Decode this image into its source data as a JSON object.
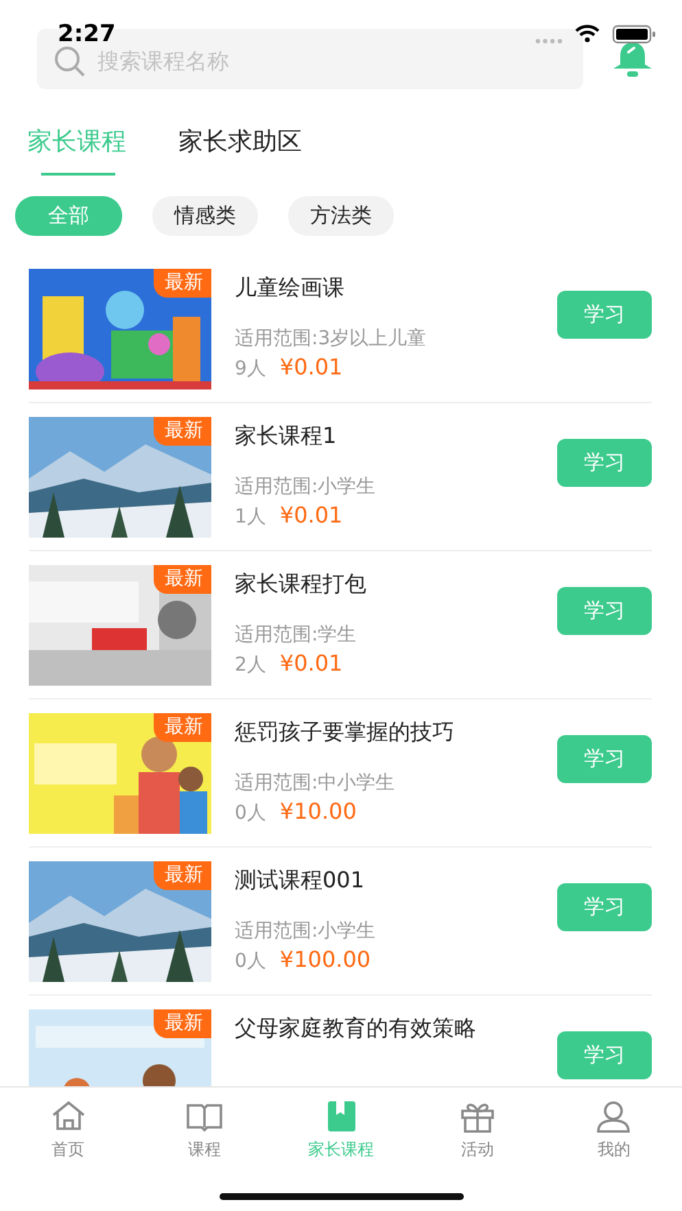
{
  "status_bar": {
    "time": "2:27"
  },
  "search": {
    "placeholder": "搜索课程名称"
  },
  "tabs": [
    {
      "label": "家长课程",
      "selected": true
    },
    {
      "label": "家长求助区",
      "selected": false
    }
  ],
  "filters": [
    {
      "label": "全部",
      "selected": true
    },
    {
      "label": "情感类",
      "selected": false
    },
    {
      "label": "方法类",
      "selected": false
    }
  ],
  "courses": [
    {
      "title": "儿童绘画课",
      "badge": "最新",
      "scope": "适用范围:3岁以上儿童",
      "count": "9人",
      "price": "¥0.01",
      "button": "学习"
    },
    {
      "title": "家长课程1",
      "badge": "最新",
      "scope": "适用范围:小学生",
      "count": "1人",
      "price": "¥0.01",
      "button": "学习"
    },
    {
      "title": "家长课程打包",
      "badge": "最新",
      "scope": "适用范围:学生",
      "count": "2人",
      "price": "¥0.01",
      "button": "学习"
    },
    {
      "title": "惩罚孩子要掌握的技巧",
      "badge": "最新",
      "scope": "适用范围:中小学生",
      "count": "0人",
      "price": "¥10.00",
      "button": "学习"
    },
    {
      "title": "测试课程001",
      "badge": "最新",
      "scope": "适用范围:小学生",
      "count": "0人",
      "price": "¥100.00",
      "button": "学习"
    },
    {
      "title": "父母家庭教育的有效策略",
      "badge": "最新",
      "button": "学习"
    }
  ],
  "bottom_nav": [
    {
      "label": "首页",
      "selected": false
    },
    {
      "label": "课程",
      "selected": false
    },
    {
      "label": "家长课程",
      "selected": true
    },
    {
      "label": "活动",
      "selected": false
    },
    {
      "label": "我的",
      "selected": false
    }
  ]
}
